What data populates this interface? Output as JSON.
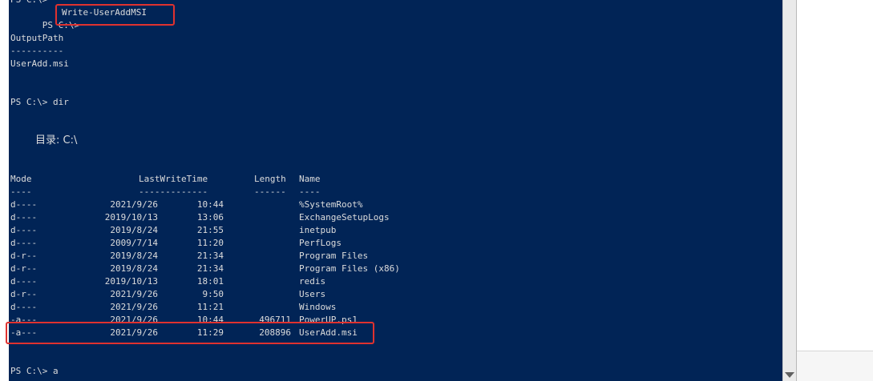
{
  "console": {
    "top_partial": "PS C:\\>",
    "prompt_1": "PS C:\\>",
    "command_1": "Write-UserAddMSI",
    "output_header": "OutputPath",
    "output_rule": "----------",
    "output_value": "UserAdd.msi",
    "prompt_2": "PS C:\\> dir",
    "directory_label": "目录: C:\\",
    "headers": {
      "mode": "Mode",
      "lastwritetime": "LastWriteTime",
      "length": "Length",
      "name": "Name"
    },
    "rules": {
      "mode": "----",
      "lastwritetime": "-------------",
      "length": "------",
      "name": "----"
    },
    "rows": [
      {
        "mode": "d----",
        "date": "2021/9/26",
        "time": "10:44",
        "length": "",
        "name": "%SystemRoot%"
      },
      {
        "mode": "d----",
        "date": "2019/10/13",
        "time": "13:06",
        "length": "",
        "name": "ExchangeSetupLogs"
      },
      {
        "mode": "d----",
        "date": "2019/8/24",
        "time": "21:55",
        "length": "",
        "name": "inetpub"
      },
      {
        "mode": "d----",
        "date": "2009/7/14",
        "time": "11:20",
        "length": "",
        "name": "PerfLogs"
      },
      {
        "mode": "d-r--",
        "date": "2019/8/24",
        "time": "21:34",
        "length": "",
        "name": "Program Files"
      },
      {
        "mode": "d-r--",
        "date": "2019/8/24",
        "time": "21:34",
        "length": "",
        "name": "Program Files (x86)"
      },
      {
        "mode": "d----",
        "date": "2019/10/13",
        "time": "18:01",
        "length": "",
        "name": "redis"
      },
      {
        "mode": "d-r--",
        "date": "2021/9/26",
        "time": "9:50",
        "length": "",
        "name": "Users"
      },
      {
        "mode": "d----",
        "date": "2021/9/26",
        "time": "11:21",
        "length": "",
        "name": "Windows"
      },
      {
        "mode": "-a---",
        "date": "2021/9/26",
        "time": "10:44",
        "length": "496711",
        "name": "PowerUP.ps1"
      },
      {
        "mode": "-a---",
        "date": "2021/9/26",
        "time": "11:29",
        "length": "208896",
        "name": "UserAdd.msi"
      }
    ],
    "prompt_3": "PS C:\\> a",
    "highlight_color": "#e0322f",
    "background_color": "#012456",
    "text_color": "#dcdcdc"
  }
}
